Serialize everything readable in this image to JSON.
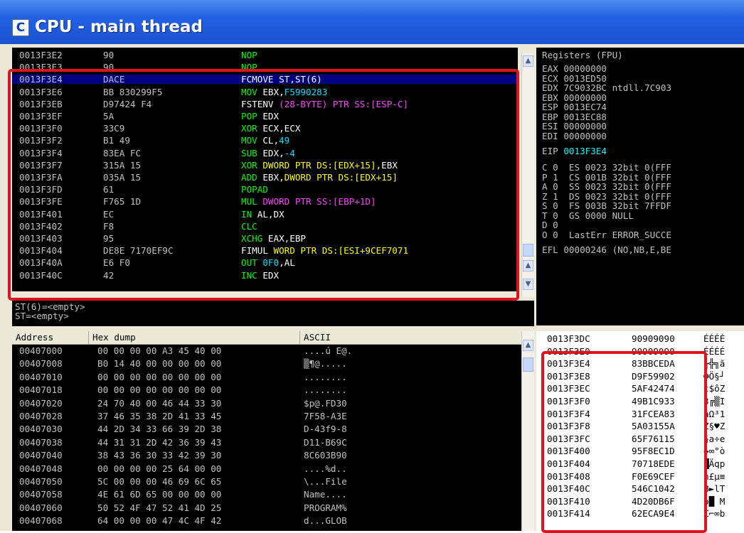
{
  "window": {
    "icon_letter": "C",
    "title": "CPU - main thread"
  },
  "disasm": {
    "rows": [
      {
        "addr": "0013F3E2",
        "hex": "90",
        "cmd": [
          [
            "NOP",
            "#00ff00"
          ]
        ]
      },
      {
        "addr": "0013F3E3",
        "hex": "90",
        "cmd": [
          [
            "NOP",
            "#00ff00"
          ]
        ]
      },
      {
        "addr": "0013F3E4",
        "hex": "DACE",
        "cmd": [
          [
            "FCMOVE ST,ST(6)",
            "#ffffff"
          ]
        ],
        "selected": true
      },
      {
        "addr": "0013F3E6",
        "hex": "BB 830299F5",
        "cmd": [
          [
            "MOV",
            "#00ff00"
          ],
          [
            " EBX,",
            "#ffffff"
          ],
          [
            "F5990283",
            "#00e0ff"
          ]
        ]
      },
      {
        "addr": "0013F3EB",
        "hex": "D97424 F4",
        "cmd": [
          [
            "FSTENV ",
            "#ffffff"
          ],
          [
            "(28-BYTE) PTR SS:[ESP-C]",
            "#ff40ff"
          ]
        ]
      },
      {
        "addr": "0013F3EF",
        "hex": "5A",
        "cmd": [
          [
            "POP",
            "#00ff00"
          ],
          [
            " EDX",
            "#ffffff"
          ]
        ]
      },
      {
        "addr": "0013F3F0",
        "hex": "33C9",
        "cmd": [
          [
            "XOR",
            "#00ff00"
          ],
          [
            " ECX,ECX",
            "#ffffff"
          ]
        ]
      },
      {
        "addr": "0013F3F2",
        "hex": "B1 49",
        "cmd": [
          [
            "MOV",
            "#00ff00"
          ],
          [
            " CL,",
            "#ffffff"
          ],
          [
            "49",
            "#00e0ff"
          ]
        ]
      },
      {
        "addr": "0013F3F4",
        "hex": "83EA FC",
        "cmd": [
          [
            "SUB",
            "#00ff00"
          ],
          [
            " EDX,",
            "#ffffff"
          ],
          [
            "-4",
            "#00e0ff"
          ]
        ]
      },
      {
        "addr": "0013F3F7",
        "hex": "315A 15",
        "cmd": [
          [
            "XOR",
            "#00ff00"
          ],
          [
            " ",
            "#ffffff"
          ],
          [
            "DWORD PTR DS:[EDX+15]",
            "#ffff00"
          ],
          [
            ",EBX",
            "#ffffff"
          ]
        ]
      },
      {
        "addr": "0013F3FA",
        "hex": "035A 15",
        "cmd": [
          [
            "ADD",
            "#00ff00"
          ],
          [
            " EBX,",
            "#ffffff"
          ],
          [
            "DWORD PTR DS:[EDX+15]",
            "#ffff00"
          ]
        ]
      },
      {
        "addr": "0013F3FD",
        "hex": "61",
        "cmd": [
          [
            "POPAD",
            "#00ff00"
          ]
        ]
      },
      {
        "addr": "0013F3FE",
        "hex": "F765 1D",
        "cmd": [
          [
            "MUL",
            "#00ff00"
          ],
          [
            " ",
            "#ffffff"
          ],
          [
            "DWORD PTR SS:[EBP+1D]",
            "#ff40ff"
          ]
        ]
      },
      {
        "addr": "0013F401",
        "hex": "EC",
        "cmd": [
          [
            "IN",
            "#00ff00"
          ],
          [
            " AL,DX",
            "#ffffff"
          ]
        ]
      },
      {
        "addr": "0013F402",
        "hex": "F8",
        "cmd": [
          [
            "CLC",
            "#00ff00"
          ]
        ]
      },
      {
        "addr": "0013F403",
        "hex": "95",
        "cmd": [
          [
            "XCHG",
            "#00ff00"
          ],
          [
            " EAX,EBP",
            "#ffffff"
          ]
        ]
      },
      {
        "addr": "0013F404",
        "hex": "DE8E 7170EF9C",
        "cmd": [
          [
            "FIMUL ",
            "#ffffff"
          ],
          [
            "WORD PTR DS:[ESI+9CEF7071",
            "#ffff00"
          ]
        ]
      },
      {
        "addr": "0013F40A",
        "hex": "E6 F0",
        "cmd": [
          [
            "OUT",
            "#00ff00"
          ],
          [
            " ",
            "#ffffff"
          ],
          [
            "0F0",
            "#00e0ff"
          ],
          [
            ",AL",
            "#ffffff"
          ]
        ]
      },
      {
        "addr": "0013F40C",
        "hex": "42",
        "cmd": [
          [
            "INC",
            "#00ff00"
          ],
          [
            " EDX",
            "#ffffff"
          ]
        ]
      }
    ]
  },
  "info": {
    "lines": [
      "ST(6)=<empty>",
      "ST=<empty>"
    ]
  },
  "registers": {
    "header": "Registers (FPU)",
    "regs": [
      {
        "name": "EAX",
        "value": "00000000",
        "comment": ""
      },
      {
        "name": "ECX",
        "value": "0013ED50",
        "comment": ""
      },
      {
        "name": "EDX",
        "value": "7C9032BC",
        "comment": "ntdll.7C903"
      },
      {
        "name": "EBX",
        "value": "00000000",
        "comment": ""
      },
      {
        "name": "ESP",
        "value": "0013EC74",
        "comment": ""
      },
      {
        "name": "EBP",
        "value": "0013EC88",
        "comment": ""
      },
      {
        "name": "ESI",
        "value": "00000000",
        "comment": ""
      },
      {
        "name": "EDI",
        "value": "00000000",
        "comment": ""
      }
    ],
    "eip": {
      "name": "EIP",
      "value": "0013F3E4"
    },
    "flags": [
      "C 0  ES 0023 32bit 0(FFF",
      "P 1  CS 001B 32bit 0(FFF",
      "A 0  SS 0023 32bit 0(FFF",
      "Z 1  DS 0023 32bit 0(FFF",
      "S 0  FS 003B 32bit 7FFDF",
      "T 0  GS 0000 NULL",
      "D 0",
      "O 0  LastErr ERROR_SUCCE"
    ],
    "efl": "EFL 00000246 (NO,NB,E,BE"
  },
  "dump": {
    "headers": {
      "address": "Address",
      "hex": "Hex dump",
      "ascii": "ASCII"
    },
    "rows": [
      {
        "addr": "00407000",
        "hex": "00 00 00 00 A3 45 40 00",
        "ascii": "....ú E@."
      },
      {
        "addr": "00407008",
        "hex": "B0 14 40 00 00 00 00 00",
        "ascii": "▒¶@....."
      },
      {
        "addr": "00407010",
        "hex": "00 00 00 00 00 00 00 00",
        "ascii": "........"
      },
      {
        "addr": "00407018",
        "hex": "00 00 00 00 00 00 00 00",
        "ascii": "........"
      },
      {
        "addr": "00407020",
        "hex": "24 70 40 00 46 44 33 30",
        "ascii": "$p@.FD30"
      },
      {
        "addr": "00407028",
        "hex": "37 46 35 38 2D 41 33 45",
        "ascii": "7F58-A3E"
      },
      {
        "addr": "00407030",
        "hex": "44 2D 34 33 66 39 2D 38",
        "ascii": "D-43f9-8"
      },
      {
        "addr": "00407038",
        "hex": "44 31 31 2D 42 36 39 43",
        "ascii": "D11-B69C"
      },
      {
        "addr": "00407040",
        "hex": "38 43 36 30 33 42 39 30",
        "ascii": "8C603B90"
      },
      {
        "addr": "00407048",
        "hex": "00 00 00 00 25 64 00 00",
        "ascii": "....%d.."
      },
      {
        "addr": "00407050",
        "hex": "5C 00 00 00 46 69 6C 65",
        "ascii": "\\...File"
      },
      {
        "addr": "00407058",
        "hex": "4E 61 6D 65 00 00 00 00",
        "ascii": "Name...."
      },
      {
        "addr": "00407060",
        "hex": "50 52 4F 47 52 41 4D 25",
        "ascii": "PROGRAM%"
      },
      {
        "addr": "00407068",
        "hex": "64 00 00 00 47 4C 4F 42",
        "ascii": "d...GLOB"
      }
    ]
  },
  "stack": {
    "rows": [
      {
        "addr": "0013F3DC",
        "value": "90909090",
        "ascii": "ÉÉÉÉ"
      },
      {
        "addr": "0013F3E0",
        "value": "90909090",
        "ascii": "ÉÉÉÉ"
      },
      {
        "addr": "0013F3E4",
        "value": "83BBCEDA",
        "ascii": "╓╬╗ã"
      },
      {
        "addr": "0013F3E8",
        "value": "D9F59902",
        "ascii": "☻Ö§┘"
      },
      {
        "addr": "0013F3EC",
        "value": "5AF42474",
        "ascii": "t$ôZ"
      },
      {
        "addr": "0013F3F0",
        "value": "49B1C933",
        "ascii": "3╔▒I"
      },
      {
        "addr": "0013F3F4",
        "value": "31FCEA83",
        "ascii": "âΩ³1"
      },
      {
        "addr": "0013F3F8",
        "value": "5A03155A",
        "ascii": "Z§♥Z"
      },
      {
        "addr": "0013F3FC",
        "value": "65F76115",
        "ascii": "§a÷e"
      },
      {
        "addr": "0013F400",
        "value": "95F8EC1D",
        "ascii": "↔∞°ò"
      },
      {
        "addr": "0013F404",
        "value": "70718EDE",
        "ascii": "▐Äqp"
      },
      {
        "addr": "0013F408",
        "value": "F0E69CEF",
        "ascii": "∩£µ≡"
      },
      {
        "addr": "0013F40C",
        "value": "546C1042",
        "ascii": "B►lT"
      },
      {
        "addr": "0013F410",
        "value": "4D20DB6F",
        "ascii": "o█ M"
      },
      {
        "addr": "0013F414",
        "value": "62ECA9E4",
        "ascii": "Σ⌐∞b"
      }
    ]
  },
  "colors": {
    "pane_bg": "#000000",
    "text": "#c0c0c0",
    "selection": "#000080",
    "highlight_box": "#e1121d",
    "title_gradient_top": "#4f8df0",
    "title_gradient_bottom": "#1b52d0"
  }
}
